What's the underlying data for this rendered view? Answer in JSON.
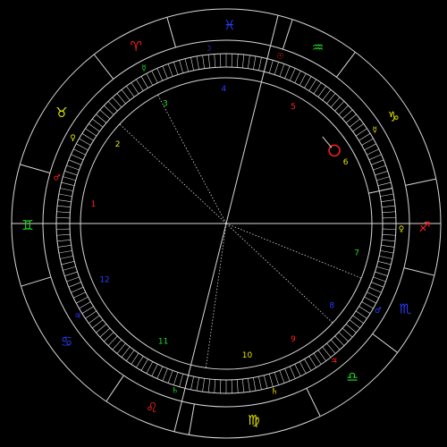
{
  "colors": {
    "red": "#ff2020",
    "green": "#22dd22",
    "yellow": "#e6e600",
    "blue": "#2a3cff",
    "line": "#d8d8d8"
  },
  "chart_data": {
    "type": "astrological-chart-wheel",
    "ascendant_deg": 180,
    "signs": [
      {
        "glyph": "♊",
        "start_deg": 164,
        "end_deg": 197,
        "color": "green"
      },
      {
        "glyph": "♉",
        "start_deg": 128,
        "end_deg": 164,
        "color": "yellow"
      },
      {
        "glyph": "♈",
        "start_deg": 106,
        "end_deg": 128,
        "color": "red"
      },
      {
        "glyph": "♓",
        "start_deg": 72,
        "end_deg": 106,
        "color": "blue"
      },
      {
        "glyph": "♒",
        "start_deg": 53,
        "end_deg": 72,
        "color": "green"
      },
      {
        "glyph": "♑",
        "start_deg": 12,
        "end_deg": 53,
        "color": "yellow"
      },
      {
        "glyph": "♐",
        "start_deg": -14,
        "end_deg": 12,
        "color": "red"
      },
      {
        "glyph": "♏",
        "start_deg": -37,
        "end_deg": -14,
        "color": "blue"
      },
      {
        "glyph": "♎",
        "start_deg": -64,
        "end_deg": -37,
        "color": "green"
      },
      {
        "glyph": "♍",
        "start_deg": -100,
        "end_deg": -64,
        "color": "yellow"
      },
      {
        "glyph": "♌",
        "start_deg": -124,
        "end_deg": -100,
        "color": "red"
      },
      {
        "glyph": "♋",
        "start_deg": -163,
        "end_deg": -124,
        "color": "blue"
      }
    ],
    "rulers": [
      {
        "glyph": "☿",
        "deg": 179,
        "r": 228,
        "color": "green"
      },
      {
        "glyph": "♀",
        "deg": 144,
        "r": 224,
        "color": "yellow"
      },
      {
        "glyph": "♂",
        "deg": 113,
        "r": 224,
        "color": "red"
      },
      {
        "glyph": "♃",
        "deg": 82,
        "r": 225,
        "color": "blue"
      },
      {
        "glyph": "♄",
        "deg": 54,
        "r": 226,
        "color": "green"
      },
      {
        "glyph": "♄",
        "deg": 28,
        "r": 226,
        "color": "yellow"
      },
      {
        "glyph": "♃",
        "deg": 1,
        "r": 227,
        "color": "red"
      },
      {
        "glyph": "♂",
        "deg": -25,
        "r": 227,
        "color": "blue"
      },
      {
        "glyph": "♀",
        "deg": -57,
        "r": 228,
        "color": "yellow"
      },
      {
        "glyph": "☿",
        "deg": -90,
        "r": 228,
        "color": "green"
      },
      {
        "glyph": "☉",
        "deg": -125,
        "r": 226,
        "color": "red"
      },
      {
        "glyph": "☽",
        "deg": -148,
        "r": 227,
        "color": "blue"
      }
    ],
    "houses": [
      {
        "num": "1",
        "deg": 172,
        "color": "red"
      },
      {
        "num": "2",
        "deg": 144,
        "color": "yellow"
      },
      {
        "num": "3",
        "deg": 117,
        "color": "green"
      },
      {
        "num": "4",
        "deg": 91,
        "color": "blue"
      },
      {
        "num": "5",
        "deg": 60,
        "color": "red"
      },
      {
        "num": "6",
        "deg": 27,
        "color": "yellow"
      },
      {
        "num": "7",
        "deg": -13,
        "color": "green"
      },
      {
        "num": "8",
        "deg": -38,
        "color": "blue"
      },
      {
        "num": "9",
        "deg": -60,
        "color": "red"
      },
      {
        "num": "10",
        "deg": -81,
        "color": "yellow"
      },
      {
        "num": "11",
        "deg": -118,
        "color": "green"
      },
      {
        "num": "12",
        "deg": -155,
        "color": "blue"
      }
    ],
    "house_rulers": [
      {
        "glyph": "♂",
        "deg": 165,
        "color": "red"
      },
      {
        "glyph": "♀",
        "deg": 151,
        "color": "yellow"
      },
      {
        "glyph": "☿",
        "deg": 118,
        "color": "green"
      },
      {
        "glyph": "☽",
        "deg": 96,
        "color": "blue"
      },
      {
        "glyph": "☉",
        "deg": 72,
        "color": "red"
      },
      {
        "glyph": "☿",
        "deg": 32,
        "color": "yellow"
      },
      {
        "glyph": "♀",
        "deg": -2,
        "color": "yellow"
      },
      {
        "glyph": "♂",
        "deg": -30,
        "color": "blue"
      },
      {
        "glyph": "♃",
        "deg": -52,
        "color": "red"
      },
      {
        "glyph": "♄",
        "deg": -74,
        "color": "yellow"
      },
      {
        "glyph": "♄",
        "deg": -107,
        "color": "green"
      },
      {
        "glyph": "♃",
        "deg": -148,
        "color": "blue"
      }
    ],
    "axes_deg": [
      0,
      180,
      76,
      256
    ],
    "aspect_lines_deg": [
      118,
      -22,
      -43,
      137,
      -98
    ],
    "sun_marker": {
      "glyph": "☉",
      "deg": 34,
      "color": "red"
    }
  }
}
